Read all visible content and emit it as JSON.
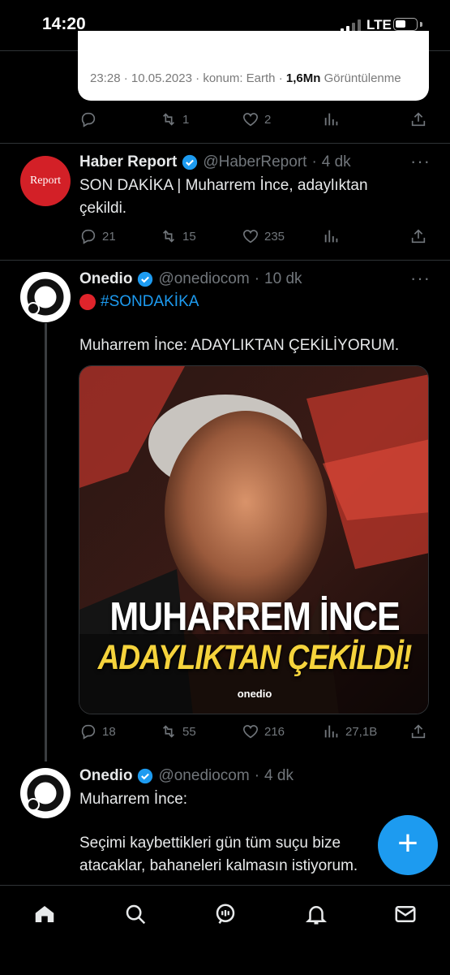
{
  "status_bar": {
    "time": "14:20",
    "network": "LTE"
  },
  "quoted_card": {
    "time": "23:28",
    "date": "10.05.2023",
    "location": "konum: Earth",
    "views_count": "1,6Mn",
    "views_label": "Görüntülenme"
  },
  "tweet0_actions": {
    "replies": "",
    "retweets": "1",
    "likes": "2"
  },
  "tweets": [
    {
      "name": "Haber Report",
      "handle": "@HaberReport",
      "time": "4 dk",
      "avatar_text": "Report",
      "text": "SON DAKİKA | Muharrem İnce, adaylıktan çekildi.",
      "replies": "21",
      "retweets": "15",
      "likes": "235"
    },
    {
      "name": "Onedio",
      "handle": "@onediocom",
      "time": "10 dk",
      "hashtag": "#SONDAKİKA",
      "text": "Muharrem İnce: ADAYLIKTAN ÇEKİLİYORUM.",
      "image_line1": "MUHARREM İNCE",
      "image_line2": "ADAYLIKTAN ÇEKİLDİ!",
      "image_brand": "onedio",
      "replies": "18",
      "retweets": "55",
      "likes": "216",
      "views": "27,1B"
    },
    {
      "name": "Onedio",
      "handle": "@onediocom",
      "time": "4 dk",
      "text_line1": "Muharrem İnce:",
      "text_line2": "Seçimi kaybettikleri gün tüm suçu bize atacaklar, bahaneleri kalmasın istiyorum."
    }
  ],
  "colors": {
    "accent": "#1d9bf0",
    "like_gold": "#f5d33c",
    "report_red": "#d32027"
  }
}
